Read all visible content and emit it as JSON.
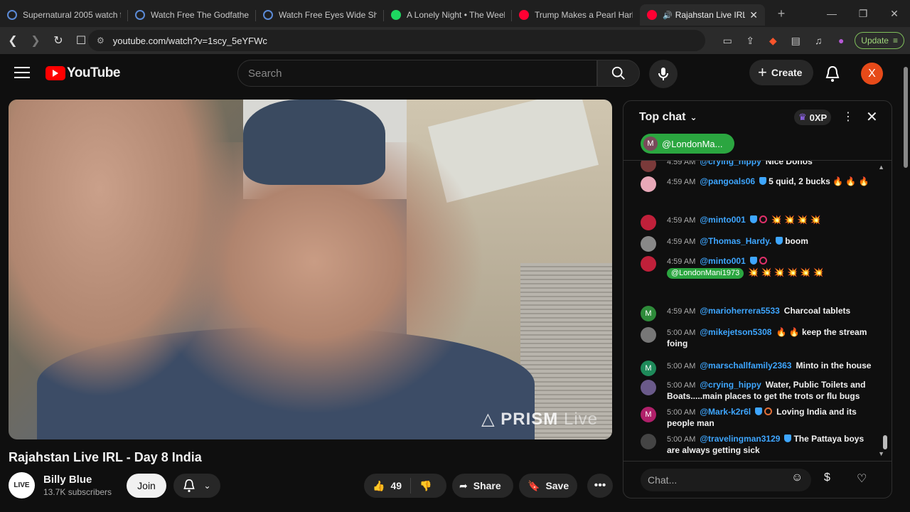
{
  "browser": {
    "tabs": [
      {
        "title": "Supernatural 2005 watch fr",
        "fav_color": "#5b8ad6"
      },
      {
        "title": "Watch Free The Godfather",
        "fav_color": "#5b8ad6"
      },
      {
        "title": "Watch Free Eyes Wide Shu",
        "fav_color": "#5b8ad6"
      },
      {
        "title": "A Lonely Night • The Week",
        "fav_color": "#1ed760"
      },
      {
        "title": "Trump Makes a Pearl Harb",
        "fav_color": "#ff0033"
      },
      {
        "title": "Rajahstan Live IRL",
        "fav_color": "#ff0033"
      }
    ],
    "url": "youtube.com/watch?v=1scy_5eYFWc",
    "update_label": "Update"
  },
  "header": {
    "logo_text": "YouTube",
    "search_placeholder": "Search",
    "create_label": "Create",
    "avatar_letter": "X"
  },
  "video": {
    "watermark_main": "PRISM",
    "watermark_sub": "Live",
    "title": "Rajahstan Live IRL - Day 8 India",
    "channel_name": "Billy Blue",
    "channel_avatar_text": "LIVE",
    "subscribers": "13.7K subscribers",
    "join_label": "Join",
    "like_count": "49",
    "share_label": "Share",
    "save_label": "Save"
  },
  "chat": {
    "mode_label": "Top chat",
    "xp_label": "0XP",
    "pinned_user": "@LondonMa...",
    "pinned_avatar": "M",
    "input_placeholder": "Chat...",
    "messages": [
      {
        "time": "4:59 AM",
        "user": "@crying_hippy",
        "text": "Nice Donos",
        "avatar": "",
        "avatar_color": "#7a3a3a"
      },
      {
        "time": "4:59 AM",
        "user": "@pangoals06",
        "text": "5 quid, 2 bucks 🔥 🔥 🔥",
        "avatar": "",
        "avatar_color": "#e8a8b8"
      },
      {
        "time": "4:59 AM",
        "user": "@minto001",
        "text": "💥 💥 💥 💥",
        "avatar": "",
        "avatar_color": "#c0203a"
      },
      {
        "time": "4:59 AM",
        "user": "@Thomas_Hardy.",
        "text": "boom",
        "avatar": "",
        "avatar_color": "#888888"
      },
      {
        "time": "4:59 AM",
        "user": "@minto001",
        "mention": "@LondonMani1973",
        "text": "💥 💥 💥 💥 💥 💥",
        "avatar": "",
        "avatar_color": "#c0203a"
      },
      {
        "time": "4:59 AM",
        "user": "@marioherrera5533",
        "text": "Charcoal tablets",
        "avatar": "M",
        "avatar_color": "#2e8b3a"
      },
      {
        "time": "5:00 AM",
        "user": "@mikejetson5308",
        "text": "🔥 🔥 keep the stream foing",
        "avatar": "",
        "avatar_color": "#777777"
      },
      {
        "time": "5:00 AM",
        "user": "@marschallfamily2363",
        "text": "Minto in the house",
        "avatar": "M",
        "avatar_color": "#1e8a5a"
      },
      {
        "time": "5:00 AM",
        "user": "@crying_hippy",
        "text": "Water, Public Toilets and Boats.....main places to get the trots or flu bugs",
        "avatar": "",
        "avatar_color": "#6a5a8a"
      },
      {
        "time": "5:00 AM",
        "user": "@Mark-k2r6l",
        "text": "Loving India and its people man",
        "avatar": "M",
        "avatar_color": "#b0206a"
      },
      {
        "time": "5:00 AM",
        "user": "@travelingman3129",
        "text": "The Pattaya boys are always getting sick",
        "avatar": "",
        "avatar_color": "#444444"
      }
    ]
  }
}
